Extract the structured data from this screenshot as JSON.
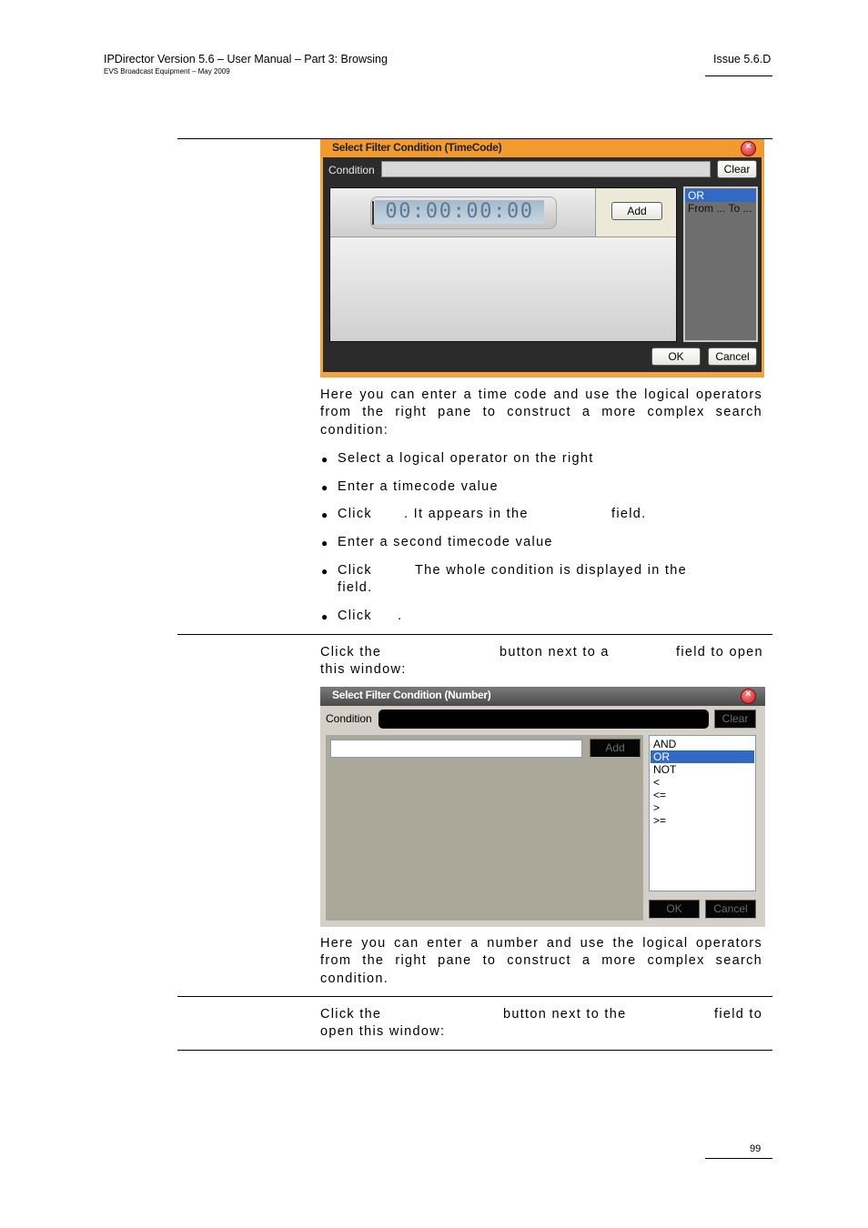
{
  "header": {
    "title": "IPDirector Version 5.6 – User Manual – Part 3: Browsing",
    "subtitle": "EVS Broadcast Equipment – May 2009",
    "issue": "Issue 5.6.D"
  },
  "dialog_timecode": {
    "title": "Select Filter Condition (TimeCode)",
    "condition_label": "Condition",
    "condition_value": "",
    "clear_label": "Clear",
    "timecode_value": "00:00:00:00",
    "add_label": "Add",
    "operators": [
      "OR",
      "From ... To ..."
    ],
    "selected_operator": "OR",
    "ok_label": "OK",
    "cancel_label": "Cancel"
  },
  "section1": {
    "intro_lines": [
      "Here you can enter a time code and use the logical operators",
      "from the right pane to construct a more complex search",
      "condition:"
    ],
    "bullets": [
      {
        "line1": "Select a logical operator on the right"
      },
      {
        "line1": "Enter a timecode value"
      },
      {
        "part_a": "Click",
        "part_b": ". It appears in the",
        "part_c": "field."
      },
      {
        "line1": "Enter a second timecode value"
      },
      {
        "part_a": "Click",
        "part_b": "The whole condition is displayed in the",
        "line2": "field."
      },
      {
        "part_a": "Click",
        "part_b": "."
      }
    ]
  },
  "section2": {
    "intro_a": "Click the",
    "intro_b": "button next to a",
    "intro_c": "field to open",
    "intro_line2": "this window:",
    "outro_lines": [
      "Here you can enter a number and use the logical operators",
      "from the right pane to construct a more complex search",
      "condition."
    ]
  },
  "dialog_number": {
    "title": "Select Filter Condition (Number)",
    "condition_label": "Condition",
    "condition_value": "",
    "clear_label": "Clear",
    "number_value": "",
    "add_label": "Add",
    "operators": [
      "AND",
      "OR",
      "NOT",
      "<",
      "<=",
      ">",
      ">="
    ],
    "selected_operator": "OR",
    "ok_label": "OK",
    "cancel_label": "Cancel"
  },
  "section3": {
    "intro_a": "Click the",
    "intro_b": "button next to the",
    "intro_c": "field to",
    "intro_line2": "open this window:"
  },
  "footer": {
    "page_number": "99"
  }
}
